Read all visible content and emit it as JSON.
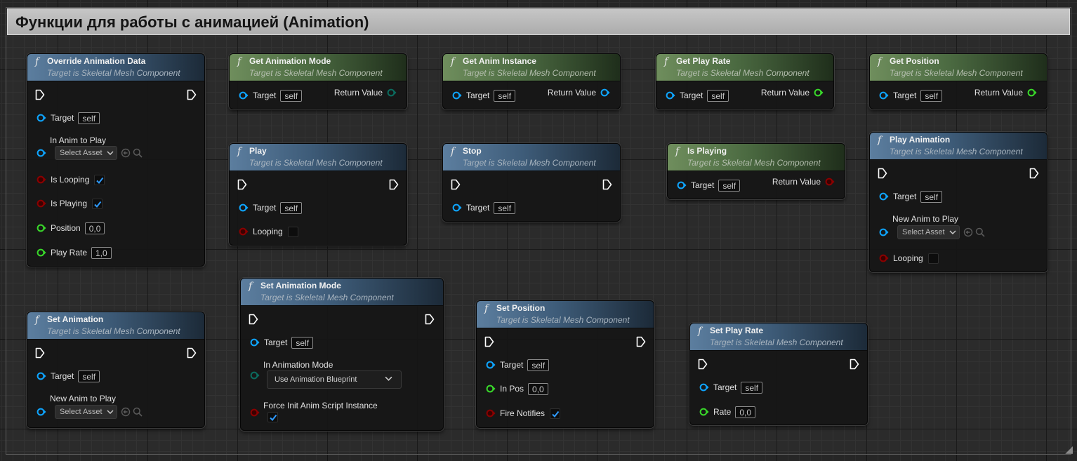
{
  "comment": {
    "title": "Функции для работы с анимацией (Animation)"
  },
  "common": {
    "target_label": "Target",
    "self_value": "self",
    "subtitle": "Target is Skeletal Mesh Component",
    "return_value_label": "Return Value",
    "select_asset": "Select Asset",
    "func_glyph": "f"
  },
  "colors": {
    "object_pin": "#0ea5ff",
    "bool_pin": "#8b0000",
    "float_pin": "#39d82a",
    "enum_pin": "#0b5d52",
    "exec_pin": "#ffffff",
    "header_blue": "#3e5c79",
    "header_green": "#4b6a41"
  },
  "nodes": {
    "override_animation_data": {
      "title": "Override Animation Data",
      "in_anim_label": "In Anim to Play",
      "is_looping_label": "Is Looping",
      "is_looping_checked": true,
      "is_playing_label": "Is Playing",
      "is_playing_checked": true,
      "position_label": "Position",
      "position_value": "0,0",
      "play_rate_label": "Play Rate",
      "play_rate_value": "1,0"
    },
    "get_animation_mode": {
      "title": "Get Animation Mode"
    },
    "get_anim_instance": {
      "title": "Get Anim Instance"
    },
    "get_play_rate": {
      "title": "Get Play Rate"
    },
    "get_position": {
      "title": "Get Position"
    },
    "play": {
      "title": "Play",
      "looping_label": "Looping",
      "looping_checked": false
    },
    "stop": {
      "title": "Stop"
    },
    "is_playing": {
      "title": "Is Playing"
    },
    "play_animation": {
      "title": "Play Animation",
      "new_anim_label": "New Anim to Play",
      "looping_label": "Looping",
      "looping_checked": false
    },
    "set_animation": {
      "title": "Set Animation",
      "new_anim_label": "New Anim to Play"
    },
    "set_animation_mode": {
      "title": "Set Animation Mode",
      "mode_label": "In Animation Mode",
      "mode_value": "Use Animation Blueprint",
      "force_init_label": "Force Init Anim Script Instance",
      "force_init_checked": true
    },
    "set_position": {
      "title": "Set Position",
      "in_pos_label": "In Pos",
      "in_pos_value": "0,0",
      "fire_notifies_label": "Fire Notifies",
      "fire_notifies_checked": true
    },
    "set_play_rate": {
      "title": "Set Play Rate",
      "rate_label": "Rate",
      "rate_value": "0,0"
    }
  }
}
